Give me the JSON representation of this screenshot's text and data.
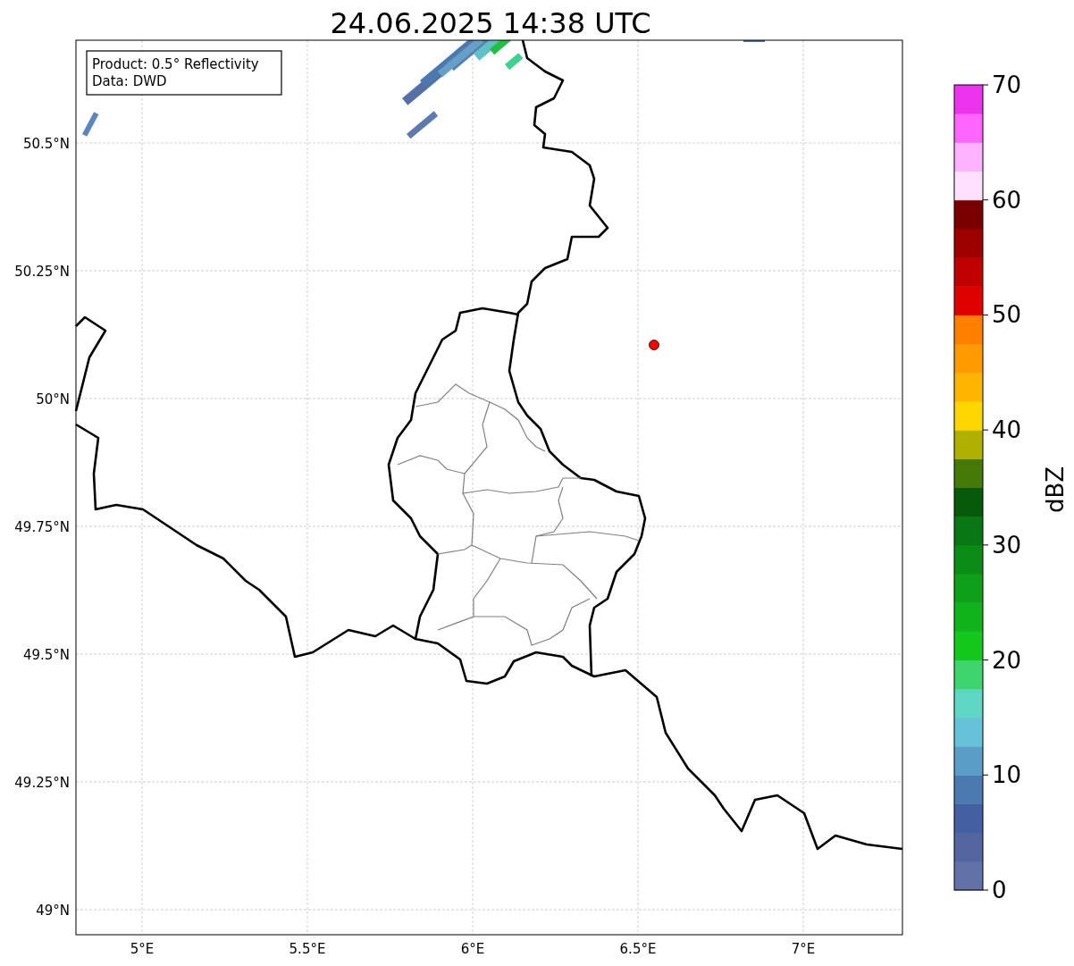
{
  "title": "24.06.2025 14:38 UTC",
  "info_box": [
    "Product: 0.5° Reflectivity",
    "Data: DWD"
  ],
  "map": {
    "x_ticks": [
      "5°E",
      "5.5°E",
      "6°E",
      "6.5°E",
      "7°E"
    ],
    "y_ticks": [
      "50.5°N",
      "50.25°N",
      "50°N",
      "49.75°N",
      "49.5°N",
      "49.25°N",
      "49°N"
    ]
  },
  "colorbar": {
    "label": "dBZ",
    "ticks": [
      "70",
      "60",
      "50",
      "40",
      "30",
      "20",
      "10",
      "0"
    ],
    "bins": [
      {
        "color": "#6272a8"
      },
      {
        "color": "#5366a0"
      },
      {
        "color": "#4460a2"
      },
      {
        "color": "#4c7ab0"
      },
      {
        "color": "#5a9ec8"
      },
      {
        "color": "#66c2d8"
      },
      {
        "color": "#60d6c4"
      },
      {
        "color": "#3ed46e"
      },
      {
        "color": "#12c81a"
      },
      {
        "color": "#10b41a"
      },
      {
        "color": "#0da018"
      },
      {
        "color": "#0b8c16"
      },
      {
        "color": "#0a7812"
      },
      {
        "color": "#065a0a"
      },
      {
        "color": "#457a08"
      },
      {
        "color": "#b0b000"
      },
      {
        "color": "#ffd700"
      },
      {
        "color": "#ffb400"
      },
      {
        "color": "#ff9a00"
      },
      {
        "color": "#ff7f00"
      },
      {
        "color": "#e00000"
      },
      {
        "color": "#c00000"
      },
      {
        "color": "#9e0000"
      },
      {
        "color": "#7a0000"
      },
      {
        "color": "#ffe0ff"
      },
      {
        "color": "#ffb3ff"
      },
      {
        "color": "#ff66ff"
      },
      {
        "color": "#ee33ee"
      }
    ]
  }
}
